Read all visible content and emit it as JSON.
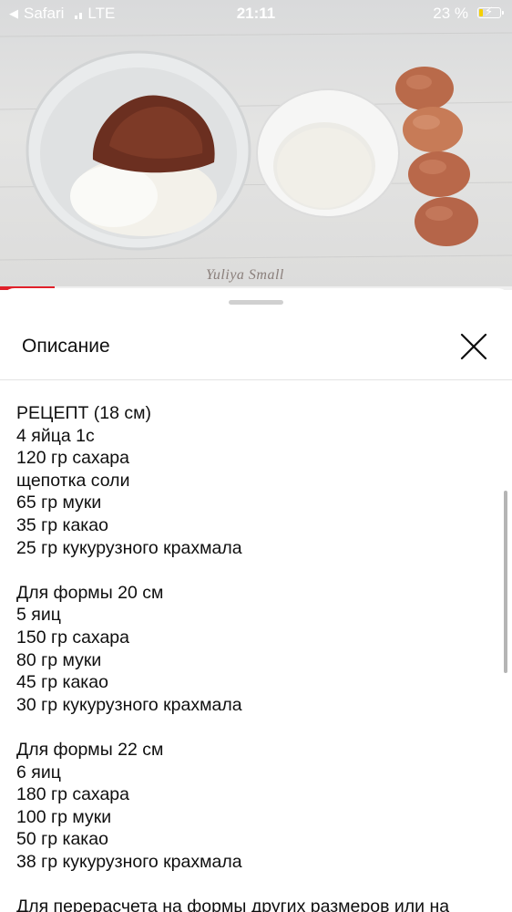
{
  "status_bar": {
    "back_app": "Safari",
    "network": "LTE",
    "time": "21:11",
    "battery_percent": "23 %",
    "battery_level": 0.23
  },
  "video": {
    "watermark": "Yuliya Small",
    "progress": 0.107,
    "accent_color": "#e0202a"
  },
  "sheet": {
    "title": "Описание",
    "close_icon": "close-icon"
  },
  "description": {
    "sections": [
      [
        "РЕЦЕПТ (18 см)",
        "4 яйца 1с",
        "120 гр сахара",
        "щепотка соли",
        "65 гр муки",
        "35 гр какао",
        "25 гр кукурузного крахмала"
      ],
      [
        "Для формы 20 см",
        "5 яиц",
        "150 гр сахара",
        "80 гр муки",
        "45 гр какао",
        "30 гр кукурузного крахмала"
      ],
      [
        "Для формы 22 см",
        "6 яиц",
        "180 гр сахара",
        "100 гр муки",
        "50 гр какао",
        "38 гр кукурузного крахмала"
      ],
      [
        "Для перерасчета на формы других размеров или на"
      ]
    ]
  }
}
